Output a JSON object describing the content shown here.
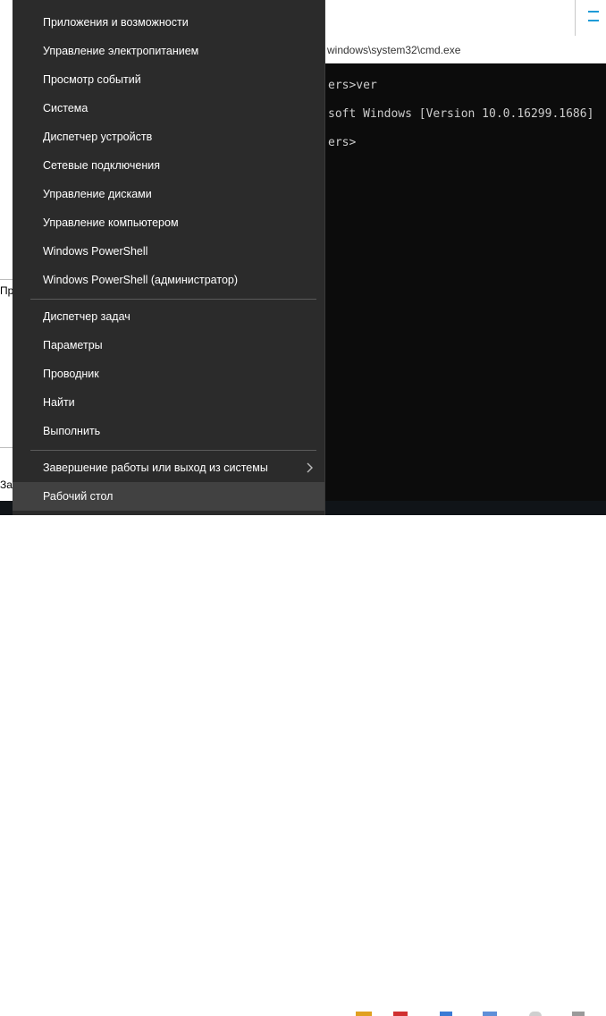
{
  "background": {
    "left_text_1": "Пр",
    "left_text_2": "За"
  },
  "cmd": {
    "title": "windows\\system32\\cmd.exe",
    "lines": [
      "ers>ver",
      "soft Windows [Version 10.0.16299.1686]",
      "ers>"
    ]
  },
  "menu": {
    "group1": [
      "Приложения и возможности",
      "Управление электропитанием",
      "Просмотр событий",
      "Система",
      "Диспетчер устройств",
      "Сетевые подключения",
      "Управление дисками",
      "Управление компьютером",
      "Windows PowerShell",
      "Windows PowerShell (администратор)"
    ],
    "group2": [
      "Диспетчер задач",
      "Параметры",
      "Проводник",
      "Найти",
      "Выполнить"
    ],
    "group3": [
      "Завершение работы или выход из системы",
      "Рабочий стол"
    ]
  },
  "colors": {
    "menu_bg": "#2b2b2b",
    "menu_hover": "#414141",
    "menu_text": "#ffffff",
    "cmd_bg": "#0c0c0c",
    "cmd_text": "#cccccc"
  }
}
